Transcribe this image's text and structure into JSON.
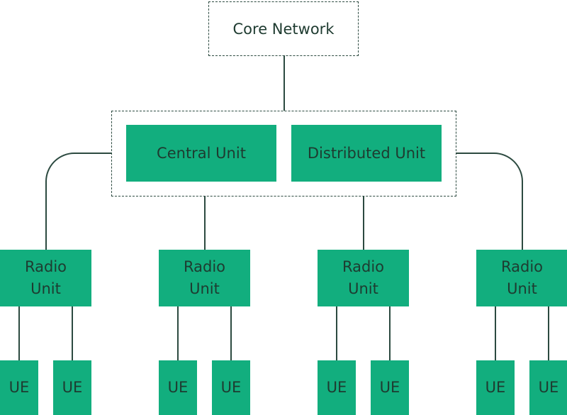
{
  "core_network": {
    "label": "Core Network"
  },
  "central_unit": {
    "label": "Central Unit"
  },
  "distributed_unit": {
    "label": "Distributed Unit"
  },
  "radio_units": [
    {
      "label": "Radio\nUnit",
      "ues": [
        "UE",
        "UE"
      ]
    },
    {
      "label": "Radio\nUnit",
      "ues": [
        "UE",
        "UE"
      ]
    },
    {
      "label": "Radio\nUnit",
      "ues": [
        "UE",
        "UE"
      ]
    },
    {
      "label": "Radio\nUnit",
      "ues": [
        "UE",
        "UE"
      ]
    }
  ],
  "colors": {
    "node_fill": "#12ae7e",
    "line": "#2c4a40",
    "text": "#1e3b30"
  }
}
